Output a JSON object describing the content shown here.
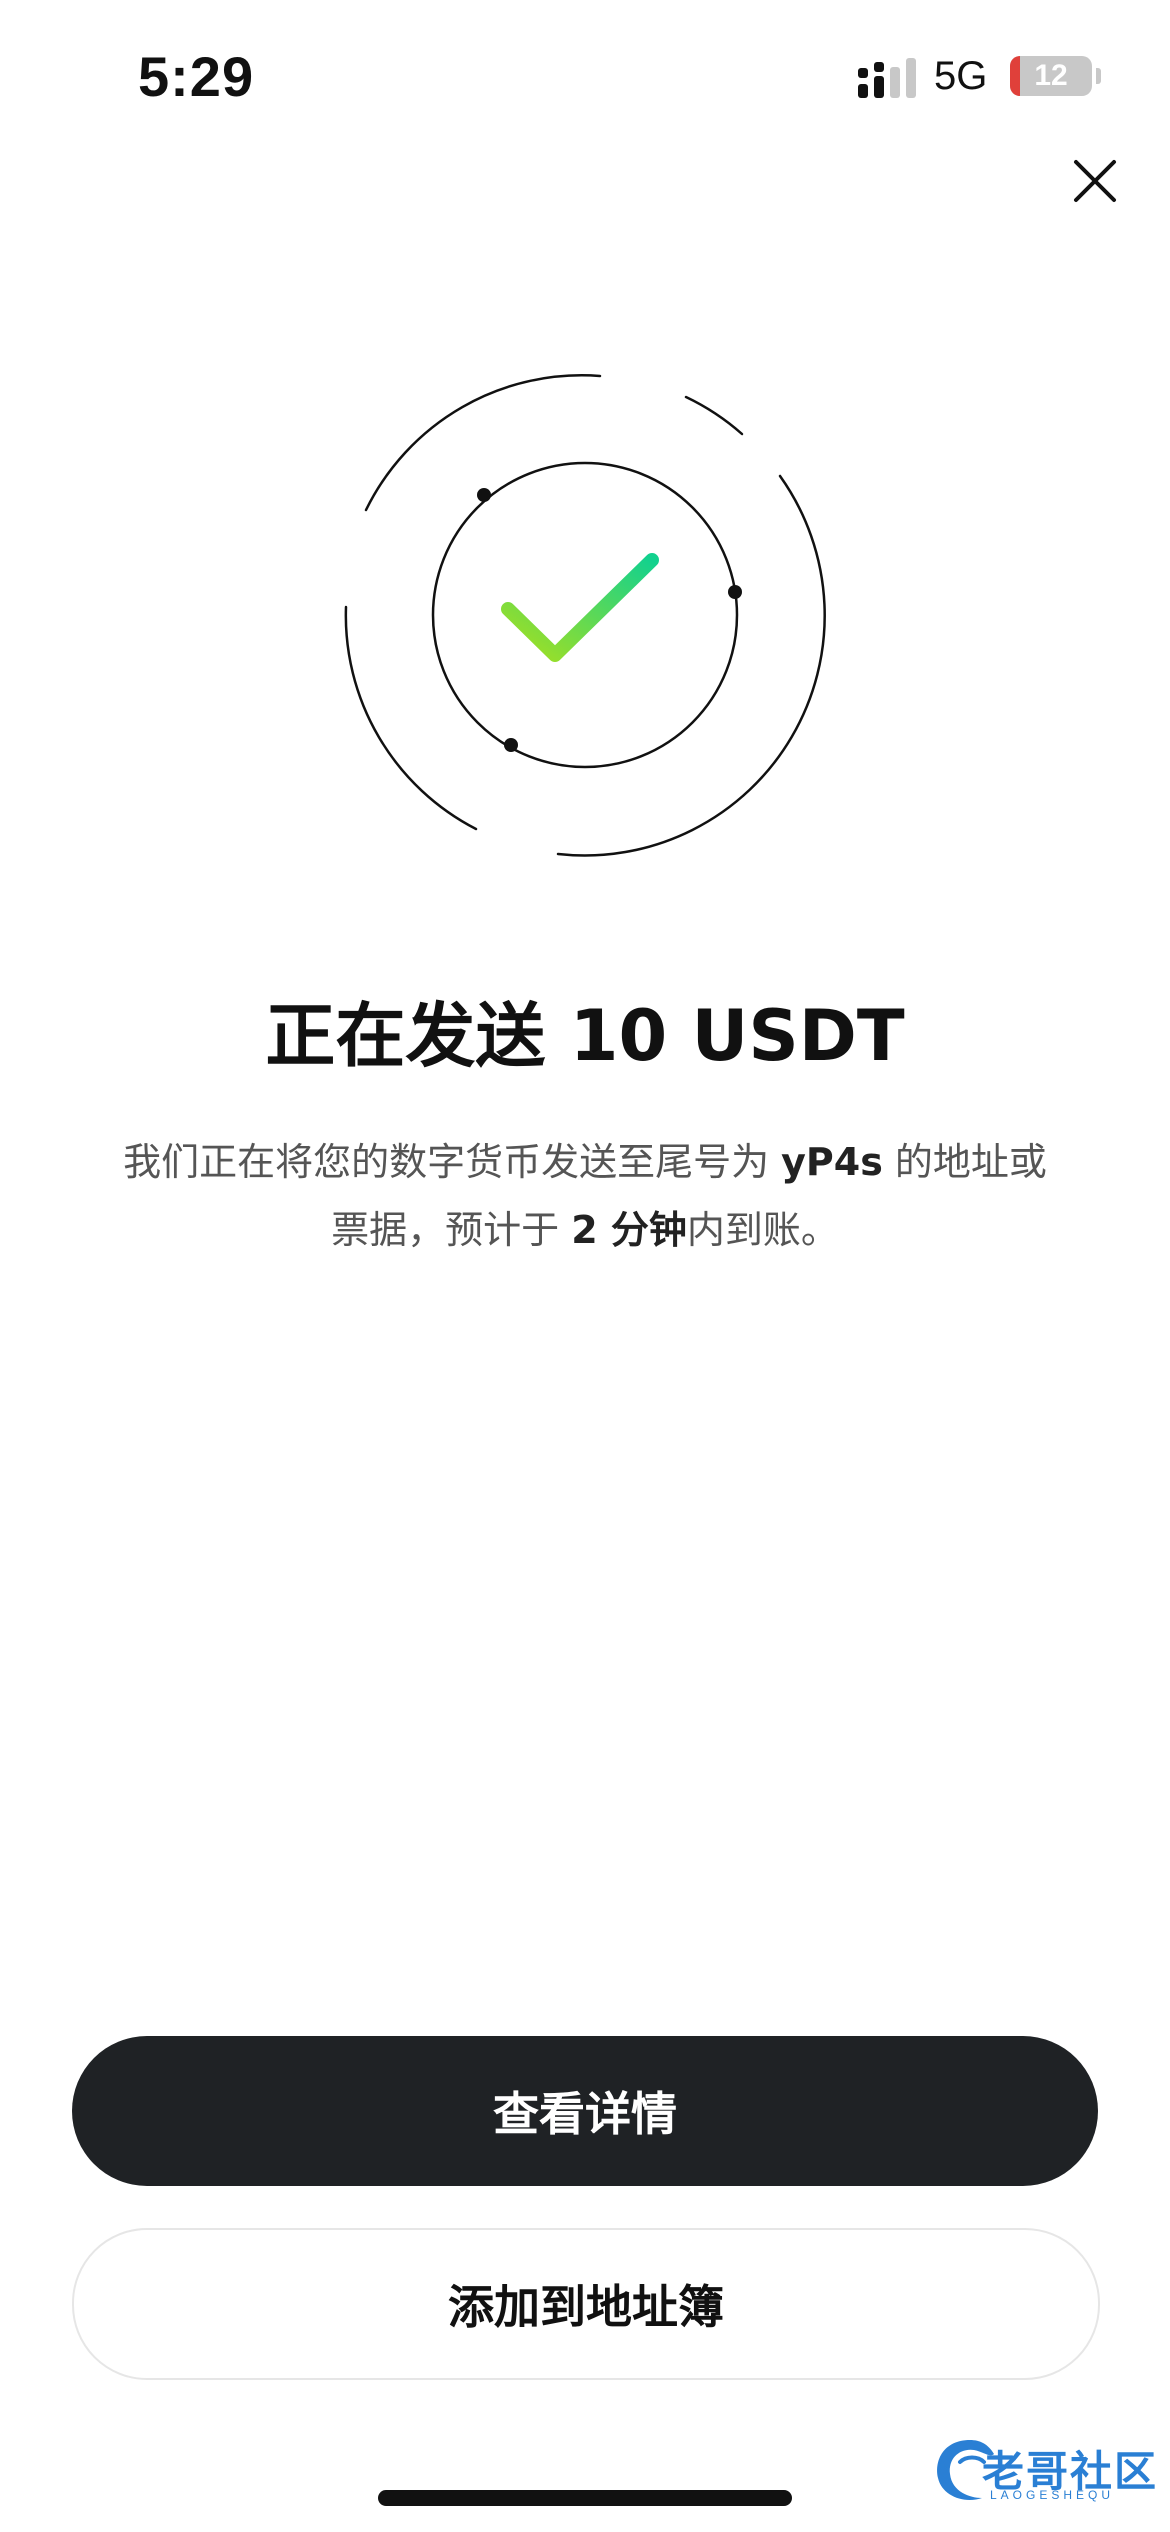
{
  "status_bar": {
    "time": "5:29",
    "network": "5G",
    "battery_level": 12,
    "battery_label": "12"
  },
  "title": {
    "prefix": "正在发送 ",
    "amount": "10 USDT"
  },
  "description": {
    "part1": "我们正在将您的数字货币发送至尾号为 ",
    "address_suffix": "yP4s",
    "part2": " 的地址或票据，预计于 ",
    "eta": "2 分钟",
    "part3": "内到账。"
  },
  "actions": {
    "view_details": "查看详情",
    "add_to_address_book": "添加到地址簿"
  },
  "colors": {
    "check_gradient_start": "#a7e01f",
    "check_gradient_end": "#12d18e",
    "primary_button_bg": "#1f2225",
    "battery_low": "#e0403a"
  },
  "icons": {
    "close": "close-icon",
    "success": "check-icon"
  },
  "watermark": {
    "text": "老哥社区",
    "subtext": "LAOGESHEQU"
  }
}
